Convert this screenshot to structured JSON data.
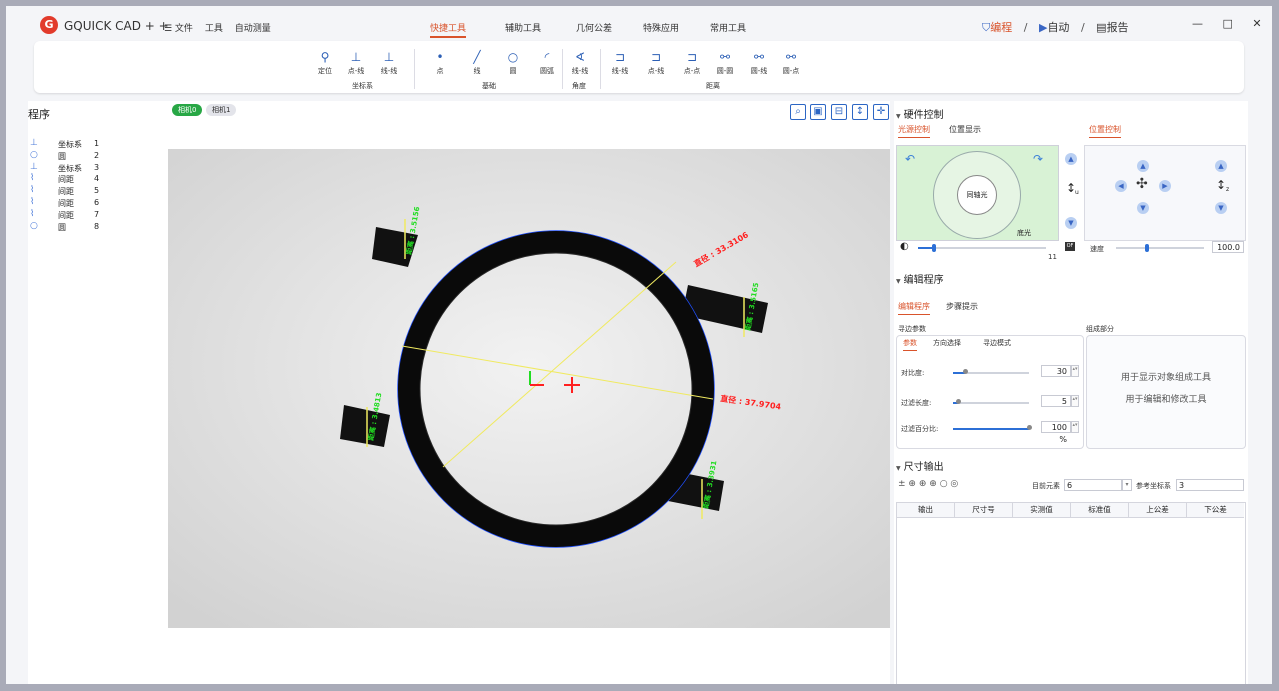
{
  "titlebar": {
    "app_name": "GQUICK CAD + +",
    "menu": [
      "☰ 文件",
      "工具",
      "自动测量"
    ],
    "tabs": [
      "快捷工具",
      "辅助工具",
      "几何公差",
      "特殊应用",
      "常用工具"
    ],
    "active_tab": "快捷工具",
    "modes": [
      "编程",
      "自动",
      "报告"
    ],
    "active_mode": "编程",
    "separator": "/",
    "window_buttons": {
      "minimize": "—",
      "maximize": "□",
      "close": "✕"
    }
  },
  "ribbon": {
    "buttons": [
      "定位",
      "点-线",
      "线-线",
      "点",
      "线",
      "圆",
      "圆弧",
      "线-线",
      "线-线",
      "点-线",
      "点-点",
      "圆-圆",
      "圆-线",
      "圆-点"
    ],
    "groups": [
      "坐标系",
      "基础",
      "角度",
      "距离"
    ]
  },
  "program": {
    "title": "程序",
    "items": [
      {
        "icon": "coord-icon",
        "name": "坐标系",
        "index": "1"
      },
      {
        "icon": "circle-icon",
        "name": "圆",
        "index": "2"
      },
      {
        "icon": "coord-icon",
        "name": "坐标系",
        "index": "3"
      },
      {
        "icon": "distance-icon",
        "name": "间距",
        "index": "4"
      },
      {
        "icon": "distance-icon",
        "name": "间距",
        "index": "5"
      },
      {
        "icon": "distance-icon",
        "name": "间距",
        "index": "6"
      },
      {
        "icon": "distance-icon",
        "name": "间距",
        "index": "7"
      },
      {
        "icon": "circle-icon",
        "name": "圆",
        "index": "8"
      }
    ]
  },
  "camera": {
    "tabs": [
      "相机0",
      "相机1"
    ],
    "active": "相机0",
    "tools": [
      "search-icon",
      "image-icon",
      "fit-icon",
      "vertical-icon",
      "crosshair-icon"
    ]
  },
  "measurements": {
    "diameter_top": "直径 : 33.3106",
    "diameter_right": "直径 : 37.9704",
    "dist_top_left": "距离 : 3.5156",
    "dist_top_right": "距离 : 3.5165",
    "dist_bottom_left": "距离 : 3.4813",
    "dist_bottom_right": "距离 : 3.3931"
  },
  "hardware": {
    "title": "硬件控制",
    "light_tabs": [
      "光源控制",
      "位置显示"
    ],
    "position_tab": "位置控制",
    "coaxial_label": "同轴光",
    "bottom_light_label": "底光",
    "brightness": 11,
    "off_label": "OF",
    "u_axis": "u",
    "z_axis": "z",
    "speed_label": "速度",
    "speed_value": "100.0"
  },
  "edit": {
    "title": "编辑程序",
    "tabs": [
      "编辑程序",
      "步骤提示"
    ],
    "edge_params_label": "寻边参数",
    "param_tabs": [
      "参数",
      "方向选择",
      "寻边模式"
    ],
    "params": [
      {
        "label": "对比度:",
        "value": "30",
        "fraction": 0.15
      },
      {
        "label": "过滤长度:",
        "value": "5",
        "fraction": 0.05
      },
      {
        "label": "过滤百分比:",
        "value": "100 %",
        "fraction": 1.0
      }
    ],
    "composition_label": "组成部分",
    "composition_hints": [
      "用于显示对象组成工具",
      "用于编辑和修改工具"
    ]
  },
  "output": {
    "title": "尺寸输出",
    "current_element_label": "目前元素",
    "current_element_value": "6",
    "ref_coord_label": "参考坐标系",
    "ref_coord_value": "3",
    "columns": [
      "输出",
      "尺寸号",
      "实测值",
      "标准值",
      "上公差",
      "下公差"
    ]
  },
  "colors": {
    "accent": "#d9532b",
    "brand_red": "#e23b2c",
    "icon_blue": "#2c5fb5",
    "measure_green": "#22dd22",
    "measure_red": "#ff2020",
    "ring_outline": "#2050ff"
  }
}
